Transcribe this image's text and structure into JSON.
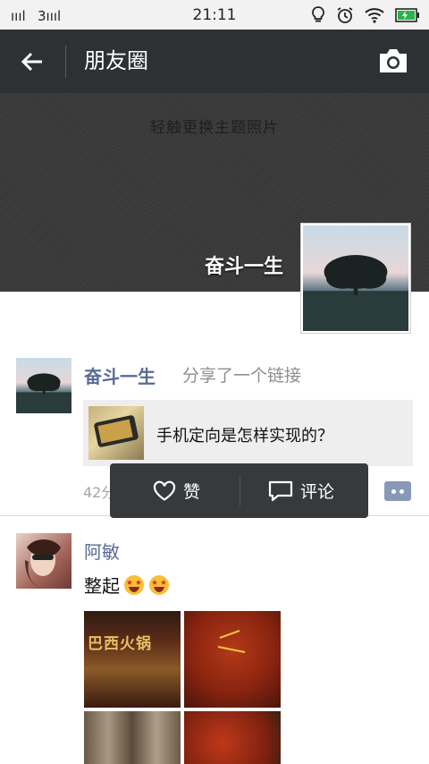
{
  "status_bar": {
    "signal1": "ıııl",
    "signal2": "3ıııl",
    "time": "21:11",
    "icons": [
      "lightbulb-icon",
      "alarm-icon",
      "wifi-icon",
      "battery-icon"
    ],
    "battery_color": "#2bb24c"
  },
  "nav": {
    "title": "朋友圈",
    "back_icon": "arrow-left-icon",
    "camera_icon": "camera-icon",
    "background": "#2e3133"
  },
  "cover": {
    "hint": "轻触更换主题照片",
    "owner_name": "奋斗一生"
  },
  "post1": {
    "name": "奋斗一生",
    "action": "分享了一个链接",
    "link_title": "手机定向是怎样实现的？",
    "time": "42分"
  },
  "popup": {
    "like_label": "赞",
    "comment_label": "评论"
  },
  "post2": {
    "name": "阿敏",
    "text": "整起",
    "emoji": [
      "star-struck-emoji",
      "star-struck-emoji"
    ],
    "photo_sign_text": "巴西火锅"
  },
  "colors": {
    "name_blue": "#576b95",
    "popup_bg": "#373a3c",
    "more_button": "#8799b7"
  }
}
